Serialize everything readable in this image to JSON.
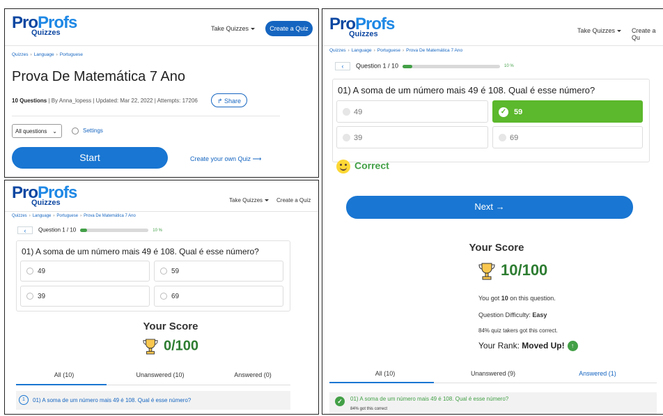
{
  "brand": {
    "pro": "Pro",
    "profs": "Profs",
    "quizzes": "Quizzes"
  },
  "nav": {
    "take_quizzes": "Take Quizzes",
    "create_quiz": "Create a Quiz",
    "create_quiz_cut": "Create a Qu"
  },
  "breadcrumb": {
    "items": [
      "Quizzes",
      "Language",
      "Portuguese",
      "Prova De Matemática 7 Ano"
    ]
  },
  "quiz": {
    "title": "Prova De Matemática 7 Ano",
    "questions_count": "10 Questions",
    "meta_rest": " | By Anna_lopess | Updated: Mar 22, 2022 | Attempts: 17206",
    "share": "Share",
    "filter_selected": "All questions",
    "settings": "Settings",
    "start": "Start",
    "create_own": "Create your own Quiz"
  },
  "question": {
    "progress_label": "Question 1 / 10",
    "progress_percent": "10 %",
    "progress_value": 0.1,
    "text": "01) A soma de um número mais 49 é 108. Qual é esse número?",
    "options": [
      "49",
      "59",
      "39",
      "69"
    ],
    "correct_option": "59"
  },
  "feedback": {
    "text": "Correct",
    "next": "Next"
  },
  "score": {
    "title": "Your Score",
    "initial": "0/100",
    "final": "10/100",
    "got_pre": "You got ",
    "got_points": "10",
    "got_post": " on this question.",
    "difficulty_label": "Question Difficulty: ",
    "difficulty_value": "Easy",
    "takers": "84% quiz takers got this correct.",
    "rank_label": "Your Rank: ",
    "rank_value": "Moved Up!"
  },
  "tabs_initial": {
    "all": "All (10)",
    "unanswered": "Unanswered (10)",
    "answered": "Answered (0)"
  },
  "tabs_final": {
    "all": "All (10)",
    "unanswered": "Unanswered (9)",
    "answered": "Answered (1)"
  },
  "list": {
    "item_number": "1",
    "item_text": "01) A soma de um número mais 49 é 108. Qual é esse número?",
    "item_sub": "84% got this correct"
  },
  "colors": {
    "brand_dark": "#0d47a1",
    "brand": "#1976d2",
    "correct": "#5cb82c",
    "score": "#2e7d32"
  },
  "icons": [
    "chevron-down-icon",
    "gear-icon",
    "share-arrow-icon",
    "arrow-right-icon",
    "chevron-left-icon",
    "check-icon",
    "smiley-icon",
    "trophy-icon",
    "arrow-up-icon"
  ]
}
